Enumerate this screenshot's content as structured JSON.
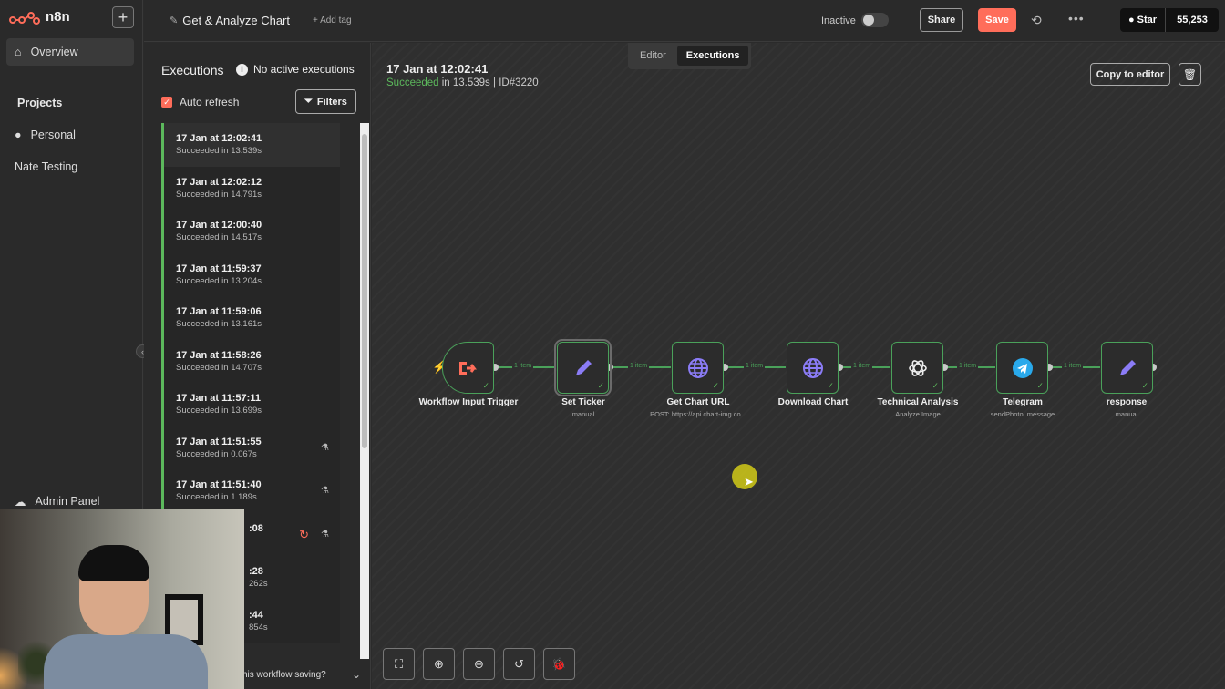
{
  "app": {
    "name": "n8n"
  },
  "nav": {
    "overview": "Overview",
    "projects_heading": "Projects",
    "personal": "Personal",
    "nate_testing": "Nate Testing",
    "admin_panel": "Admin Panel"
  },
  "topbar": {
    "workflow_title": "Get & Analyze Chart",
    "add_tag": "+ Add tag",
    "inactive_label": "Inactive",
    "share_label": "Share",
    "save_label": "Save",
    "star_label": "Star",
    "star_count": "55,253"
  },
  "executions_panel": {
    "heading": "Executions",
    "no_active": "No active executions",
    "auto_refresh": "Auto refresh",
    "filters_label": "Filters",
    "items": [
      {
        "date": "17 Jan at 12:02:41",
        "status": "Succeeded in 13.539s"
      },
      {
        "date": "17 Jan at 12:02:12",
        "status": "Succeeded in 14.791s"
      },
      {
        "date": "17 Jan at 12:00:40",
        "status": "Succeeded in 14.517s"
      },
      {
        "date": "17 Jan at 11:59:37",
        "status": "Succeeded in 13.204s"
      },
      {
        "date": "17 Jan at 11:59:06",
        "status": "Succeeded in 13.161s"
      },
      {
        "date": "17 Jan at 11:58:26",
        "status": "Succeeded in 14.707s"
      },
      {
        "date": "17 Jan at 11:57:11",
        "status": "Succeeded in 13.699s"
      },
      {
        "date": "17 Jan at 11:51:55",
        "status": "Succeeded in 0.067s"
      },
      {
        "date": "17 Jan at 11:51:40",
        "status": "Succeeded in 1.189s"
      },
      {
        "date": ":08",
        "status": ""
      },
      {
        "date": ":28",
        "status": "262s"
      },
      {
        "date": ":44",
        "status": "854s"
      }
    ],
    "saving_question": "his workflow saving?"
  },
  "canvas": {
    "tab_editor": "Editor",
    "tab_executions": "Executions",
    "run_date": "17 Jan at 12:02:41",
    "run_status_ok": "Succeeded",
    "run_status_rest": " in 13.539s | ID#3220",
    "copy_to_editor": "Copy to editor",
    "connector_label": "1 item",
    "nodes": [
      {
        "label": "Workflow Input Trigger",
        "sub": "",
        "icon": "trigger-icon"
      },
      {
        "label": "Set Ticker",
        "sub": "manual",
        "icon": "pencil-icon"
      },
      {
        "label": "Get Chart URL",
        "sub": "POST: https://api.chart-img.co...",
        "icon": "globe-icon"
      },
      {
        "label": "Download Chart",
        "sub": "",
        "icon": "globe-icon"
      },
      {
        "label": "Technical Analysis",
        "sub": "Analyze Image",
        "icon": "openai-icon"
      },
      {
        "label": "Telegram",
        "sub": "sendPhoto: message",
        "icon": "telegram-icon"
      },
      {
        "label": "response",
        "sub": "manual",
        "icon": "pencil-icon"
      }
    ]
  },
  "colors": {
    "accent": "#ff6d5a",
    "success": "#5cb85c",
    "node_purple": "#8b7cf6",
    "telegram_blue": "#29a9eb"
  }
}
